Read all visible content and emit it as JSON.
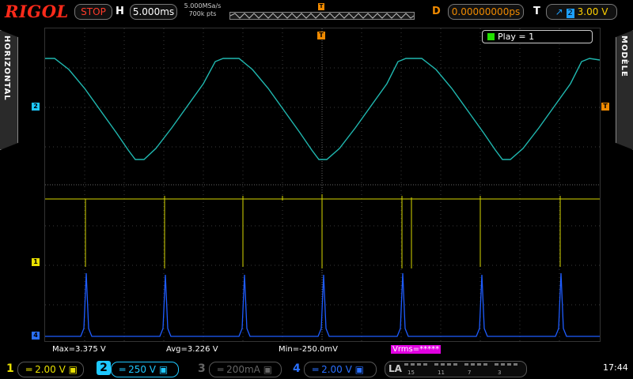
{
  "topbar": {
    "logo": "RIGOL",
    "run_state": "STOP",
    "h_label": "H",
    "timebase": "5.000ms",
    "sample_rate": "5.000MSa/s",
    "mem_depth": "700k pts",
    "d_label": "D",
    "delay": "0.00000000ps",
    "t_label": "T",
    "trigger_channel": "2",
    "trigger_level": "3.00 V"
  },
  "side": {
    "left_tab": "HORIZONTAL",
    "right_tab": "MODÈLE"
  },
  "play": {
    "label": "Play = 1"
  },
  "markers": {
    "ch2": "2",
    "ch1": "1",
    "ch4": "4",
    "trig": "T"
  },
  "measurements": {
    "max": "Max=3.375 V",
    "avg": "Avg=3.226 V",
    "min": "Min=-250.0mV",
    "vrms": "Vrms=*****"
  },
  "channels": [
    {
      "num": "1",
      "scale": "2.00 V",
      "color": "#e8e000"
    },
    {
      "num": "2",
      "scale": "250 V",
      "color": "#1ec8ff"
    },
    {
      "num": "3",
      "scale": "200mA",
      "color": "#666666"
    },
    {
      "num": "4",
      "scale": "2.00 V",
      "color": "#2a70ff"
    }
  ],
  "la": {
    "label": "LA",
    "nums": [
      "15",
      "11",
      "7",
      "3"
    ]
  },
  "clock": "17:44",
  "colors": {
    "ch2_trace": "#20b8b0",
    "ch1_trace": "#d8d800",
    "ch4_trace": "#1e5cff",
    "accent": "#f08a00"
  }
}
